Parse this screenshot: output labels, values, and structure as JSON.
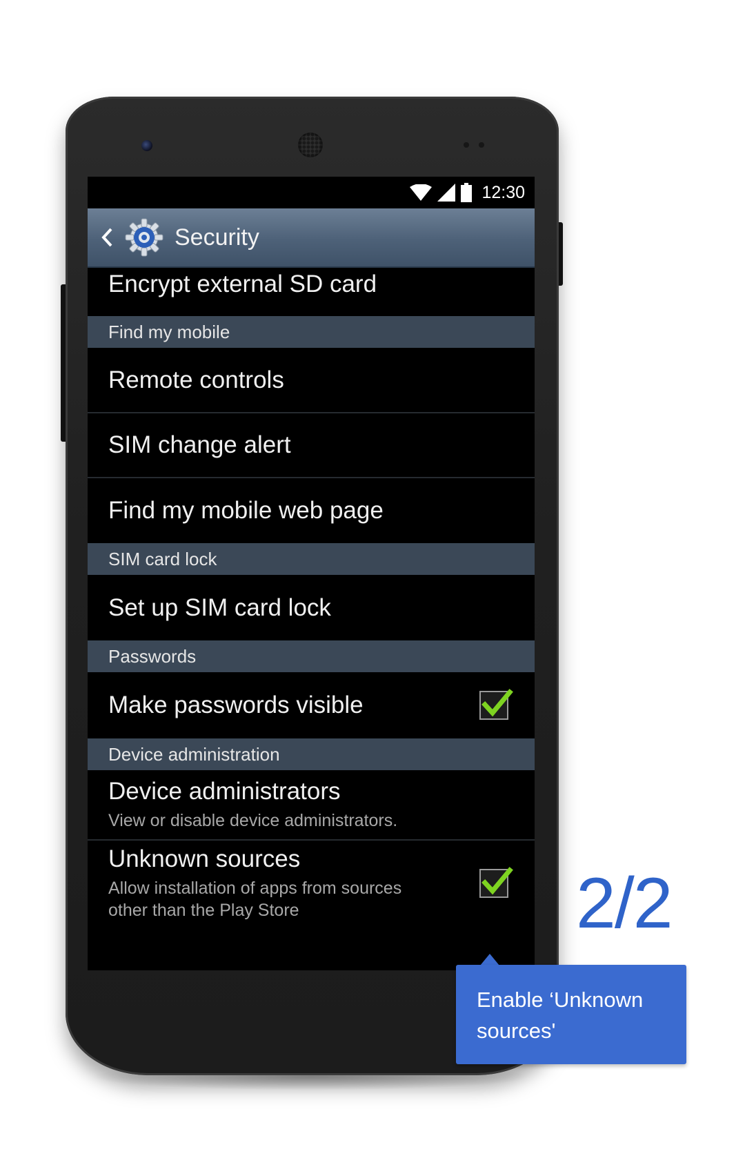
{
  "statusbar": {
    "time": "12:30"
  },
  "actionbar": {
    "title": "Security"
  },
  "settings": {
    "encrypt_sd": "Encrypt external SD card",
    "find_my_mobile": {
      "header": "Find my mobile",
      "items": [
        "Remote controls",
        "SIM change alert",
        "Find my mobile web page"
      ]
    },
    "sim_card_lock": {
      "header": "SIM card lock",
      "items": [
        "Set up SIM card lock"
      ]
    },
    "passwords": {
      "header": "Passwords",
      "make_visible": {
        "label": "Make passwords visible",
        "checked": true
      }
    },
    "device_admin": {
      "header": "Device administration",
      "administrators": {
        "label": "Device administrators",
        "summary": "View or disable device administrators."
      },
      "unknown_sources": {
        "label": "Unknown sources",
        "summary_line1": "Allow installation of apps from sources",
        "summary_line2": "other than the Play Store",
        "checked": true
      }
    }
  },
  "tutorial": {
    "step": "2/2",
    "callout_line1": "Enable ‘Unknown",
    "callout_line2": "sources'"
  },
  "colors": {
    "accent_blue": "#3b6bd0",
    "step_blue": "#2f63c9",
    "check_green": "#7ed321",
    "section_header": "#3b4857"
  }
}
